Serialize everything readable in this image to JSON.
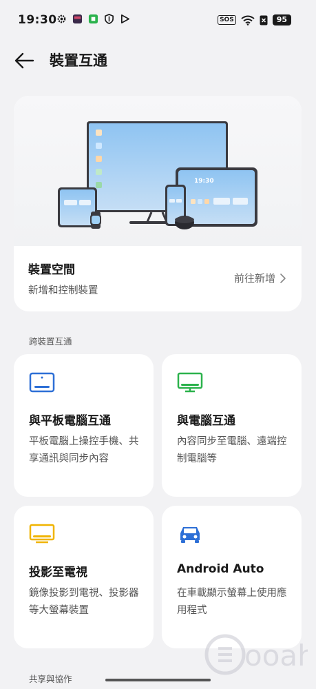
{
  "status_bar": {
    "time": "19:30",
    "sos": "SOS",
    "battery": "95",
    "left_icons": [
      "gear-icon",
      "calendar-icon",
      "app-icon",
      "shield-icon",
      "play-icon"
    ],
    "right_icons": [
      "wifi-icon",
      "no-sim-icon"
    ]
  },
  "header": {
    "title": "裝置互通",
    "back_icon": "arrow-left-icon"
  },
  "device_space": {
    "illustration_time": "19:30",
    "title": "裝置空間",
    "subtitle": "新增和控制裝置",
    "action_label": "前往新增"
  },
  "sections": {
    "cross_device": "跨裝置互通",
    "share": "共享與協作"
  },
  "features": [
    {
      "title": "與平板電腦互通",
      "desc": "平板電腦上操控手機、共享通訊與同步內容",
      "icon": "tablet-icon",
      "color": "#2d6fd6"
    },
    {
      "title": "與電腦互通",
      "desc": "內容同步至電腦、遠端控制電腦等",
      "icon": "monitor-icon",
      "color": "#2bb24c"
    },
    {
      "title": "投影至電視",
      "desc": "鏡像投影到電視、投影器等大螢幕裝置",
      "icon": "tv-icon",
      "color": "#f0b400"
    },
    {
      "title": "Android Auto",
      "desc": "在車載顯示螢幕上使用應用程式",
      "icon": "car-icon",
      "color": "#2d6fd6"
    }
  ],
  "watermark": "ooah"
}
